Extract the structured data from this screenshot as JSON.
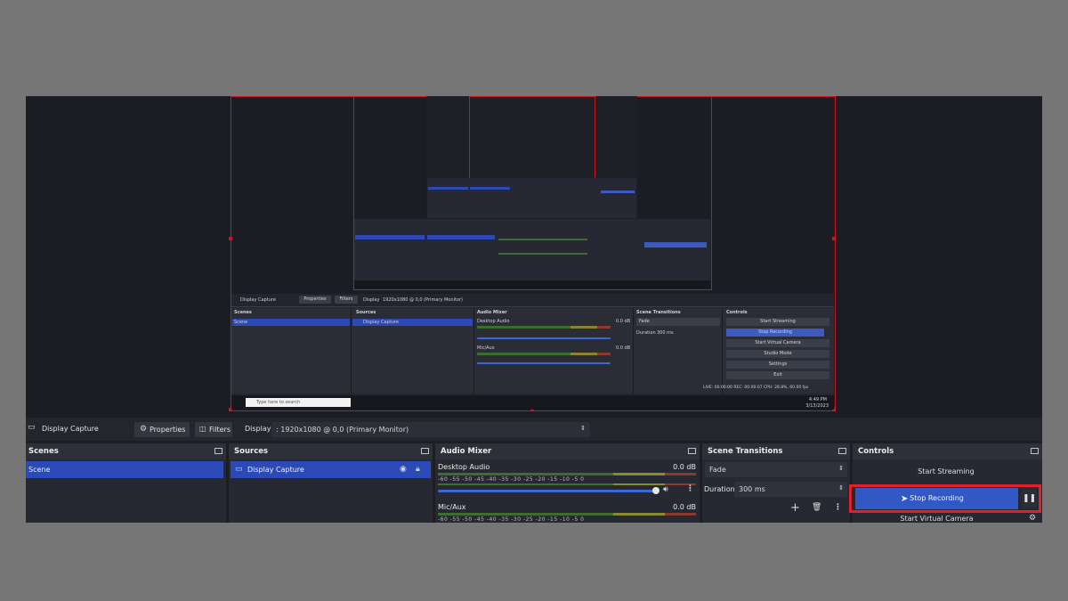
{
  "source_bar": {
    "source_name": "Display Capture",
    "properties_label": "Properties",
    "filters_label": "Filters",
    "display_label": "Display",
    "display_value": ": 1920x1080 @ 0,0 (Primary Monitor)"
  },
  "scenes": {
    "title": "Scenes",
    "items": [
      "Scene"
    ]
  },
  "sources": {
    "title": "Sources",
    "items": [
      "Display Capture"
    ]
  },
  "audio_mixer": {
    "title": "Audio Mixer",
    "channels": [
      {
        "name": "Desktop Audio",
        "level": "0.0 dB"
      },
      {
        "name": "Mic/Aux",
        "level": "0.0 dB"
      }
    ],
    "scale": "-60 -55 -50 -45 -40 -35 -30 -25 -20 -15 -10 -5 0"
  },
  "transitions": {
    "title": "Scene Transitions",
    "transition": "Fade",
    "duration_label": "Duration",
    "duration_value": "300 ms"
  },
  "controls": {
    "title": "Controls",
    "start_streaming": "Start Streaming",
    "stop_recording": "Stop Recording",
    "start_virtual_camera": "Start Virtual Camera"
  },
  "preview_text": {
    "mid_display_capture": "Display Capture",
    "mid_properties": "Properties",
    "mid_filters": "Filters",
    "mid_display": "Display",
    "mid_display_value": "1920x1080 @ 0,0 (Primary Monitor)",
    "mid_scenes": "Scenes",
    "mid_scene": "Scene",
    "mid_sources": "Sources",
    "mid_display_item": "Display Capture",
    "mid_audio_mixer": "Audio Mixer",
    "mid_desktop_audio": "Desktop Audio",
    "mid_mic": "Mic/Aux",
    "mid_db": "0.0 dB",
    "mid_transitions": "Scene Transitions",
    "mid_fade": "Fade",
    "mid_duration": "Duration",
    "mid_duration_value": "300 ms",
    "mid_controls": "Controls",
    "mid_start_streaming": "Start Streaming",
    "mid_stop_recording": "Stop Recording",
    "mid_start_virtual": "Start Virtual Camera",
    "mid_studio": "Studio Mode",
    "mid_settings": "Settings",
    "mid_exit": "Exit",
    "mid_status": "LIVE: 00:00:00     REC: 00:00:07     CPU: 28.8%, 60.00 fps",
    "mid_search": "Type here to search",
    "mid_time": "4:49 PM",
    "mid_date": "3/13/2023"
  },
  "colors": {
    "accent": "#2c49b8",
    "highlight": "#e02228",
    "red_outline": "#c8161d"
  }
}
